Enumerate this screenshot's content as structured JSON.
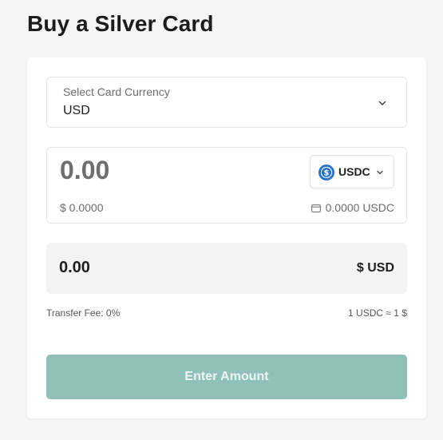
{
  "page": {
    "title": "Buy a Silver Card"
  },
  "currency_select": {
    "label": "Select Card Currency",
    "value": "USD"
  },
  "amount": {
    "placeholder": "0.00",
    "usd_value": "$ 0.0000",
    "token": {
      "symbol": "USDC",
      "icon": "usdc-coin-icon",
      "color": "#2775ca"
    },
    "balance": "0.0000 USDC"
  },
  "receive": {
    "amount": "0.00",
    "currency": "$ USD"
  },
  "fee": {
    "label": "Transfer Fee: 0%"
  },
  "rate": {
    "label": "1 USDC ≈ 1 $"
  },
  "submit": {
    "label": "Enter Amount",
    "color": "#8fc1b8"
  }
}
